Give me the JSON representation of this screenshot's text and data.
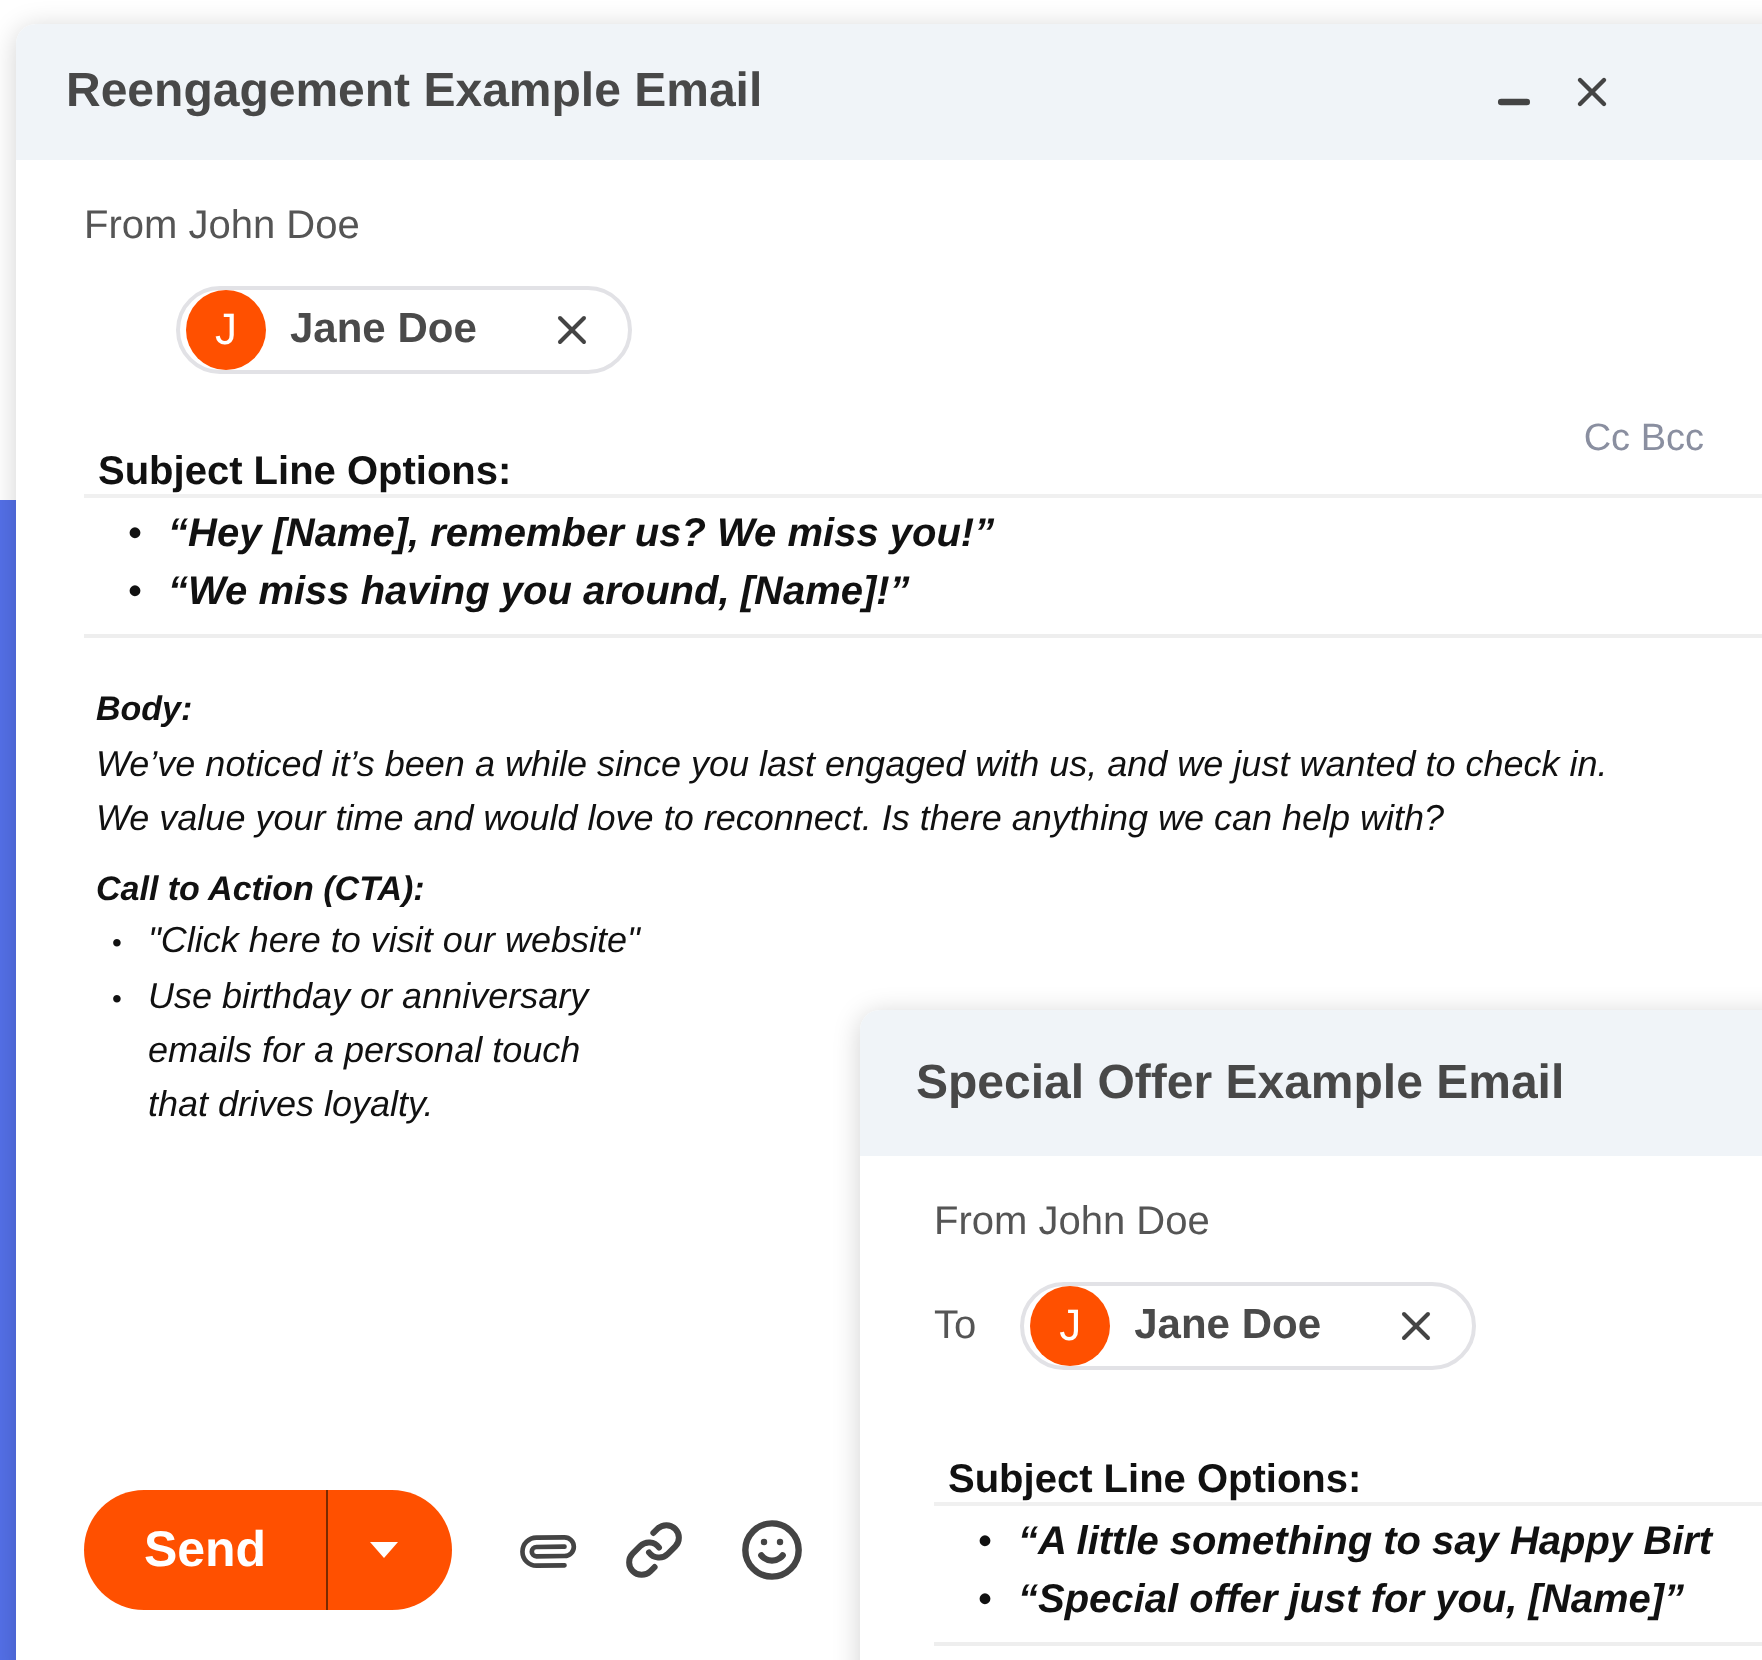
{
  "main_window": {
    "title": "Reengagement Example Email",
    "from": "From John Doe",
    "recipients": [
      {
        "initial": "J",
        "name": "Jane Doe"
      }
    ],
    "cc_bcc": "Cc Bcc",
    "subject_heading": "Subject Line Options:",
    "subject_options": [
      {
        "bullet": "•",
        "text": "“Hey [Name], remember us? We miss you!”"
      },
      {
        "bullet": "•",
        "text": "“We miss having you around, [Name]!”"
      }
    ],
    "body_heading": "Body:",
    "body_text": "We’ve noticed it’s been a while since you last engaged with us, and we just wanted to check in. We value your time and would love to reconnect. Is there anything we can help with?",
    "cta_heading": "Call to Action (CTA):",
    "cta_items": [
      {
        "bullet": "•",
        "text": "\"Click here to visit our website\""
      },
      {
        "bullet": "•",
        "text": "Use birthday or anniversary emails for a personal touch that drives loyalty."
      }
    ],
    "send_button": "Send"
  },
  "offer_window": {
    "title": "Special Offer Example Email",
    "from": "From John Doe",
    "to_label": "To",
    "recipients": [
      {
        "initial": "J",
        "name": "Jane Doe"
      }
    ],
    "subject_heading": "Subject Line Options:",
    "subject_options": [
      {
        "bullet": "•",
        "text": "“A little something to say Happy Birt"
      },
      {
        "bullet": "•",
        "text": "“Special offer just for you, [Name]”"
      }
    ]
  }
}
